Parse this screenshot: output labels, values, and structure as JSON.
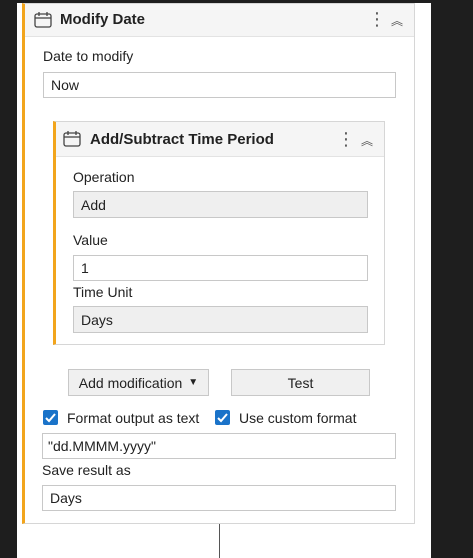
{
  "outer_card": {
    "title": "Modify Date",
    "kebab": "⋮",
    "collapse": "︽",
    "date_label": "Date to modify",
    "date_value": "Now"
  },
  "inner_card": {
    "title": "Add/Subtract Time Period",
    "kebab": "⋮",
    "collapse": "︽",
    "operation_label": "Operation",
    "operation_value": "Add",
    "value_label": "Value",
    "value_value": "1",
    "unit_label": "Time Unit",
    "unit_value": "Days"
  },
  "actions": {
    "add_modification": "Add modification",
    "caret": "▼",
    "test": "Test"
  },
  "options": {
    "format_output_label": "Format output as text",
    "format_output_checked": true,
    "custom_format_label": "Use custom format",
    "custom_format_checked": true,
    "custom_format_value": "\"dd.MMMM.yyyy\"",
    "save_label": "Save result as",
    "save_value": "Days"
  },
  "colors": {
    "accent": "#f2a51c",
    "checkbox": "#1a73c9"
  }
}
